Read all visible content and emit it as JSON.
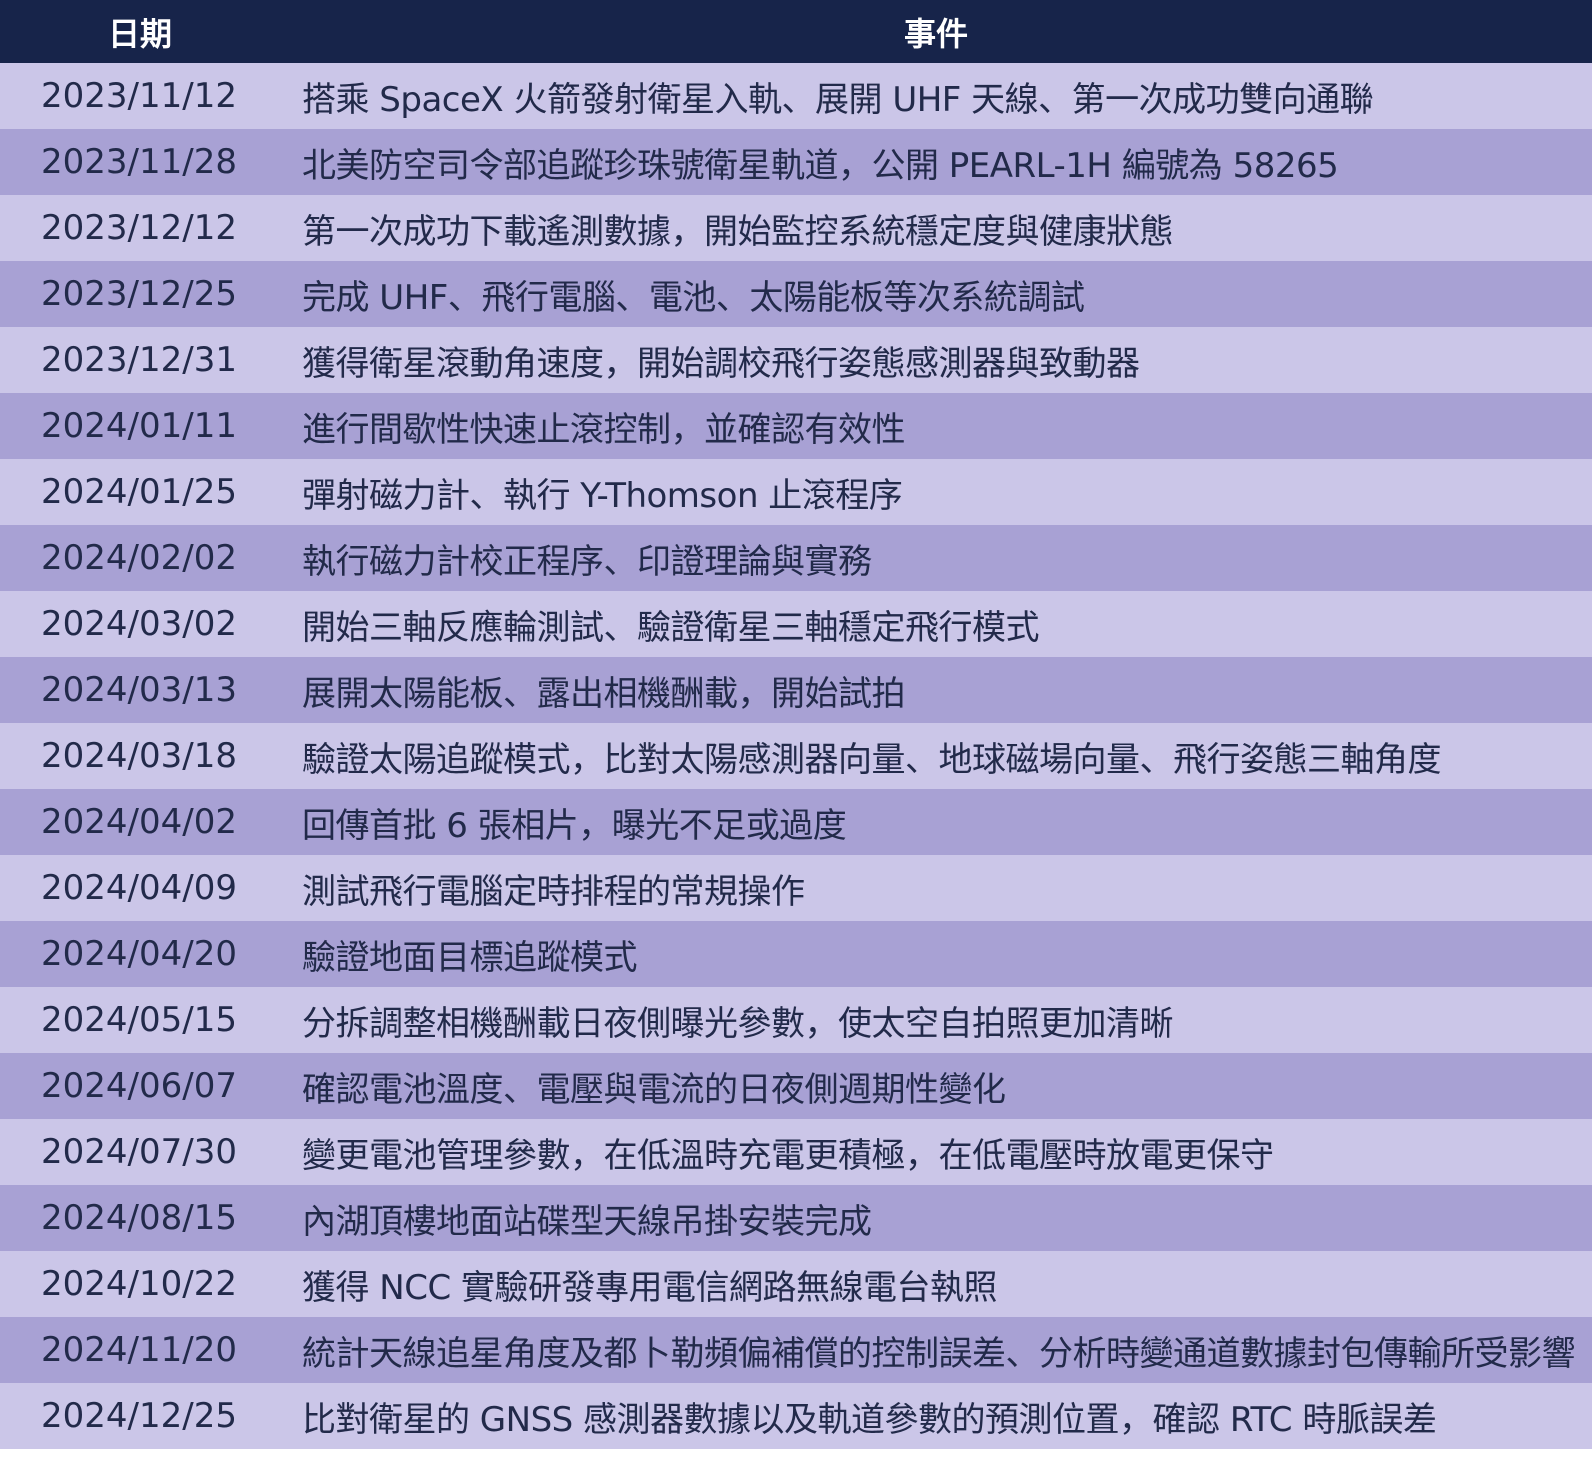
{
  "table": {
    "headers": {
      "date": "日期",
      "event": "事件"
    },
    "rows": [
      {
        "date": "2023/11/12",
        "event": "搭乘 SpaceX 火箭發射衛星入軌、展開 UHF 天線、第一次成功雙向通聯"
      },
      {
        "date": "2023/11/28",
        "event": "北美防空司令部追蹤珍珠號衛星軌道，公開 PEARL-1H 編號為 58265"
      },
      {
        "date": "2023/12/12",
        "event": "第一次成功下載遙測數據，開始監控系統穩定度與健康狀態"
      },
      {
        "date": "2023/12/25",
        "event": "完成 UHF、飛行電腦、電池、太陽能板等次系統調試"
      },
      {
        "date": "2023/12/31",
        "event": "獲得衛星滾動角速度，開始調校飛行姿態感測器與致動器"
      },
      {
        "date": "2024/01/11",
        "event": "進行間歇性快速止滾控制，並確認有效性"
      },
      {
        "date": "2024/01/25",
        "event": "彈射磁力計、執行 Y-Thomson 止滾程序"
      },
      {
        "date": "2024/02/02",
        "event": "執行磁力計校正程序、印證理論與實務"
      },
      {
        "date": "2024/03/02",
        "event": "開始三軸反應輪測試、驗證衛星三軸穩定飛行模式"
      },
      {
        "date": "2024/03/13",
        "event": "展開太陽能板、露出相機酬載，開始試拍"
      },
      {
        "date": "2024/03/18",
        "event": "驗證太陽追蹤模式，比對太陽感測器向量、地球磁場向量、飛行姿態三軸角度"
      },
      {
        "date": "2024/04/02",
        "event": "回傳首批 6 張相片，曝光不足或過度"
      },
      {
        "date": "2024/04/09",
        "event": "測試飛行電腦定時排程的常規操作"
      },
      {
        "date": "2024/04/20",
        "event": "驗證地面目標追蹤模式"
      },
      {
        "date": "2024/05/15",
        "event": "分拆調整相機酬載日夜側曝光參數，使太空自拍照更加清晰"
      },
      {
        "date": "2024/06/07",
        "event": "確認電池溫度、電壓與電流的日夜側週期性變化"
      },
      {
        "date": "2024/07/30",
        "event": "變更電池管理參數，在低溫時充電更積極，在低電壓時放電更保守"
      },
      {
        "date": "2024/08/15",
        "event": "內湖頂樓地面站碟型天線吊掛安裝完成"
      },
      {
        "date": "2024/10/22",
        "event": "獲得 NCC 實驗研發專用電信網路無線電台執照"
      },
      {
        "date": "2024/11/20",
        "event": "統計天線追星角度及都卜勒頻偏補償的控制誤差、分析時變通道數據封包傳輸所受影響"
      },
      {
        "date": "2024/12/25",
        "event": "比對衛星的 GNSS 感測器數據以及軌道參數的預測位置，確認 RTC 時脈誤差"
      }
    ]
  },
  "colors": {
    "header_bg": "#17244a",
    "header_text": "#ffffff",
    "row_odd": "#cbc6e8",
    "row_even": "#a8a1d4",
    "body_text": "#222a4a"
  }
}
